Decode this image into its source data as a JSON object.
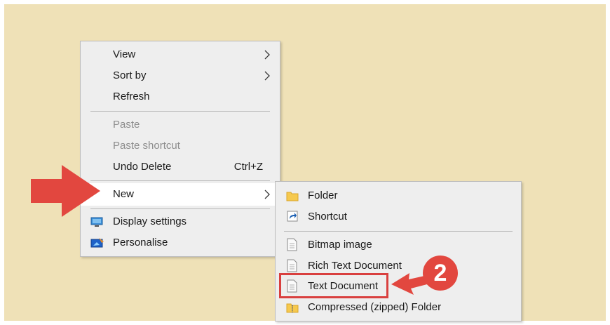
{
  "context_menu": {
    "items": [
      {
        "label": "View",
        "has_submenu": true,
        "enabled": true
      },
      {
        "label": "Sort by",
        "has_submenu": true,
        "enabled": true
      },
      {
        "label": "Refresh",
        "enabled": true
      },
      {
        "label": "Paste",
        "enabled": false
      },
      {
        "label": "Paste shortcut",
        "enabled": false
      },
      {
        "label": "Undo Delete",
        "shortcut": "Ctrl+Z",
        "enabled": true
      },
      {
        "label": "New",
        "has_submenu": true,
        "enabled": true,
        "highlighted": true
      },
      {
        "label": "Display settings",
        "icon": "display-icon",
        "enabled": true
      },
      {
        "label": "Personalise",
        "icon": "personalise-icon",
        "enabled": true
      }
    ]
  },
  "new_submenu": {
    "items": [
      {
        "label": "Folder",
        "icon": "folder-icon"
      },
      {
        "label": "Shortcut",
        "icon": "shortcut-icon"
      },
      {
        "label": "Bitmap image",
        "icon": "document-icon"
      },
      {
        "label": "Rich Text Document",
        "icon": "document-icon"
      },
      {
        "label": "Text Document",
        "icon": "document-icon",
        "highlighted_by_callout": true
      },
      {
        "label": "Compressed (zipped) Folder",
        "icon": "zip-folder-icon"
      }
    ]
  },
  "annotations": {
    "step_number": "2",
    "arrow_color": "#e2473f"
  },
  "colors": {
    "desktop": "#efe1b7",
    "menu_bg": "#eeeeee",
    "highlight": "#ffffff",
    "annotation_red": "#e2473f"
  }
}
